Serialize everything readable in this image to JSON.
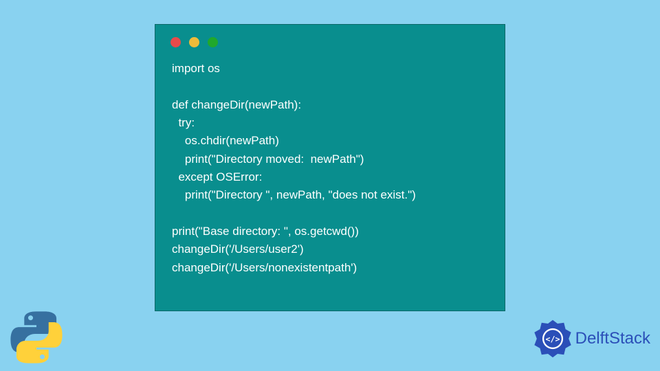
{
  "code": {
    "line1": "import os",
    "line2": "",
    "line3": "def changeDir(newPath):",
    "line4": "  try:",
    "line5": "    os.chdir(newPath)",
    "line6": "    print(\"Directory moved:  newPath\")",
    "line7": "  except OSError:",
    "line8": "    print(\"Directory \", newPath, \"does not exist.\")",
    "line9": "",
    "line10": "print(\"Base directory: \", os.getcwd())",
    "line11": "changeDir('/Users/user2')",
    "line12": "changeDir('/Users/nonexistentpath')"
  },
  "brand": {
    "name": "DelftStack"
  }
}
